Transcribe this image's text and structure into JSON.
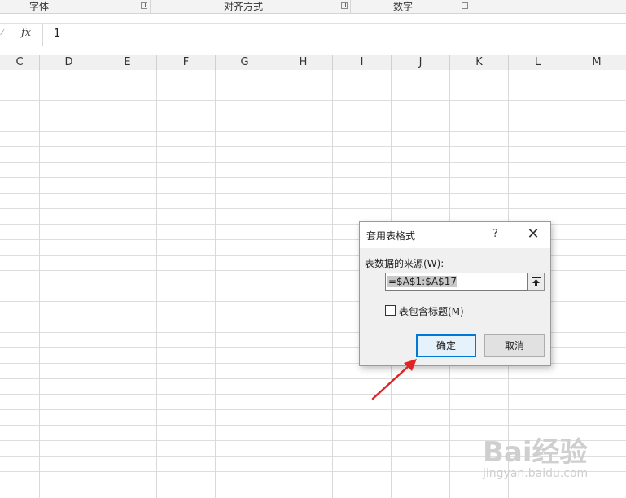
{
  "ribbon": {
    "groups": [
      {
        "label": "字体"
      },
      {
        "label": "对齐方式"
      },
      {
        "label": "数字"
      }
    ]
  },
  "formula_bar": {
    "fx_label": "fx",
    "value": "1"
  },
  "sheet": {
    "columns": [
      "C",
      "D",
      "E",
      "F",
      "G",
      "H",
      "I",
      "J",
      "K",
      "L",
      "M"
    ]
  },
  "dialog": {
    "title": "套用表格式",
    "help": "?",
    "close": "✕",
    "source_label": "表数据的来源(W):",
    "range_value": "=$A$1:$A$17",
    "checkbox_label": "表包含标题(M)",
    "checkbox_checked": false,
    "ok_label": "确定",
    "cancel_label": "取消"
  },
  "annotation": {
    "arrow_color": "#e02424"
  },
  "watermark": {
    "logo": "Bai经验",
    "url": "jingyan.baidu.com"
  }
}
